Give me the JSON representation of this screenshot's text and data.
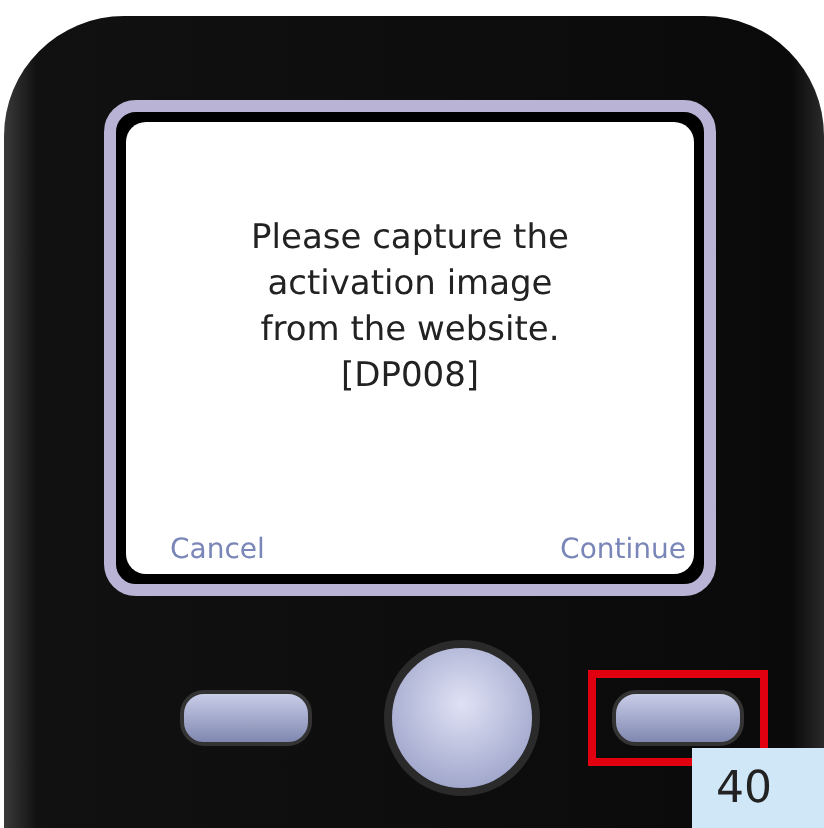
{
  "screen": {
    "message_lines": [
      "Please capture the",
      "activation image",
      "from the website.",
      "[DP008]"
    ],
    "softkeys": [
      {
        "label": "Cancel"
      },
      {
        "label": "Continue"
      }
    ]
  },
  "buttons": [
    {
      "kind": "softkey",
      "highlighted": false
    },
    {
      "kind": "nav",
      "highlighted": false
    },
    {
      "kind": "softkey",
      "highlighted": true
    }
  ],
  "page_number": "40"
}
